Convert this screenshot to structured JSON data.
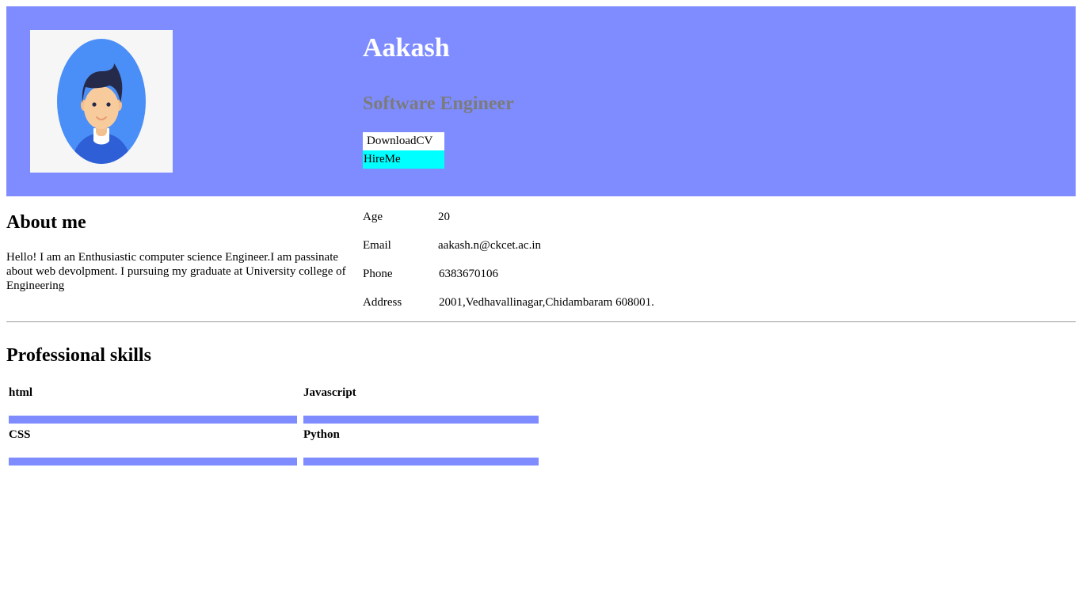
{
  "profile": {
    "name": "Aakash",
    "role": "Software Engineer",
    "download_label": "DownloadCV",
    "hire_label": "HireMe"
  },
  "about": {
    "title": "About me",
    "text": "Hello! I am an Enthusiastic computer science Engineer.I am passinate about web devolpment. I pursuing my graduate at University college of Engineering"
  },
  "info": {
    "age_label": "Age",
    "age": "20",
    "email_label": "Email",
    "email": "aakash.n@ckcet.ac.in",
    "phone_label": "Phone",
    "phone": "6383670106",
    "address_label": "Address",
    "address": "2001,Vedhavallinagar,Chidambaram 608001."
  },
  "skills": {
    "title": "Professional skills",
    "items": [
      {
        "label": "html",
        "level": 1.0
      },
      {
        "label": "Javascript",
        "level": 1.0
      },
      {
        "label": "CSS",
        "level": 1.0
      },
      {
        "label": "Python",
        "level": 1.0
      }
    ]
  },
  "colors": {
    "header_bg": "#7f8cff",
    "hire_bg": "#00ffff",
    "bar_fill": "#7f8cff"
  },
  "icons": {
    "avatar": "user-avatar-icon"
  }
}
